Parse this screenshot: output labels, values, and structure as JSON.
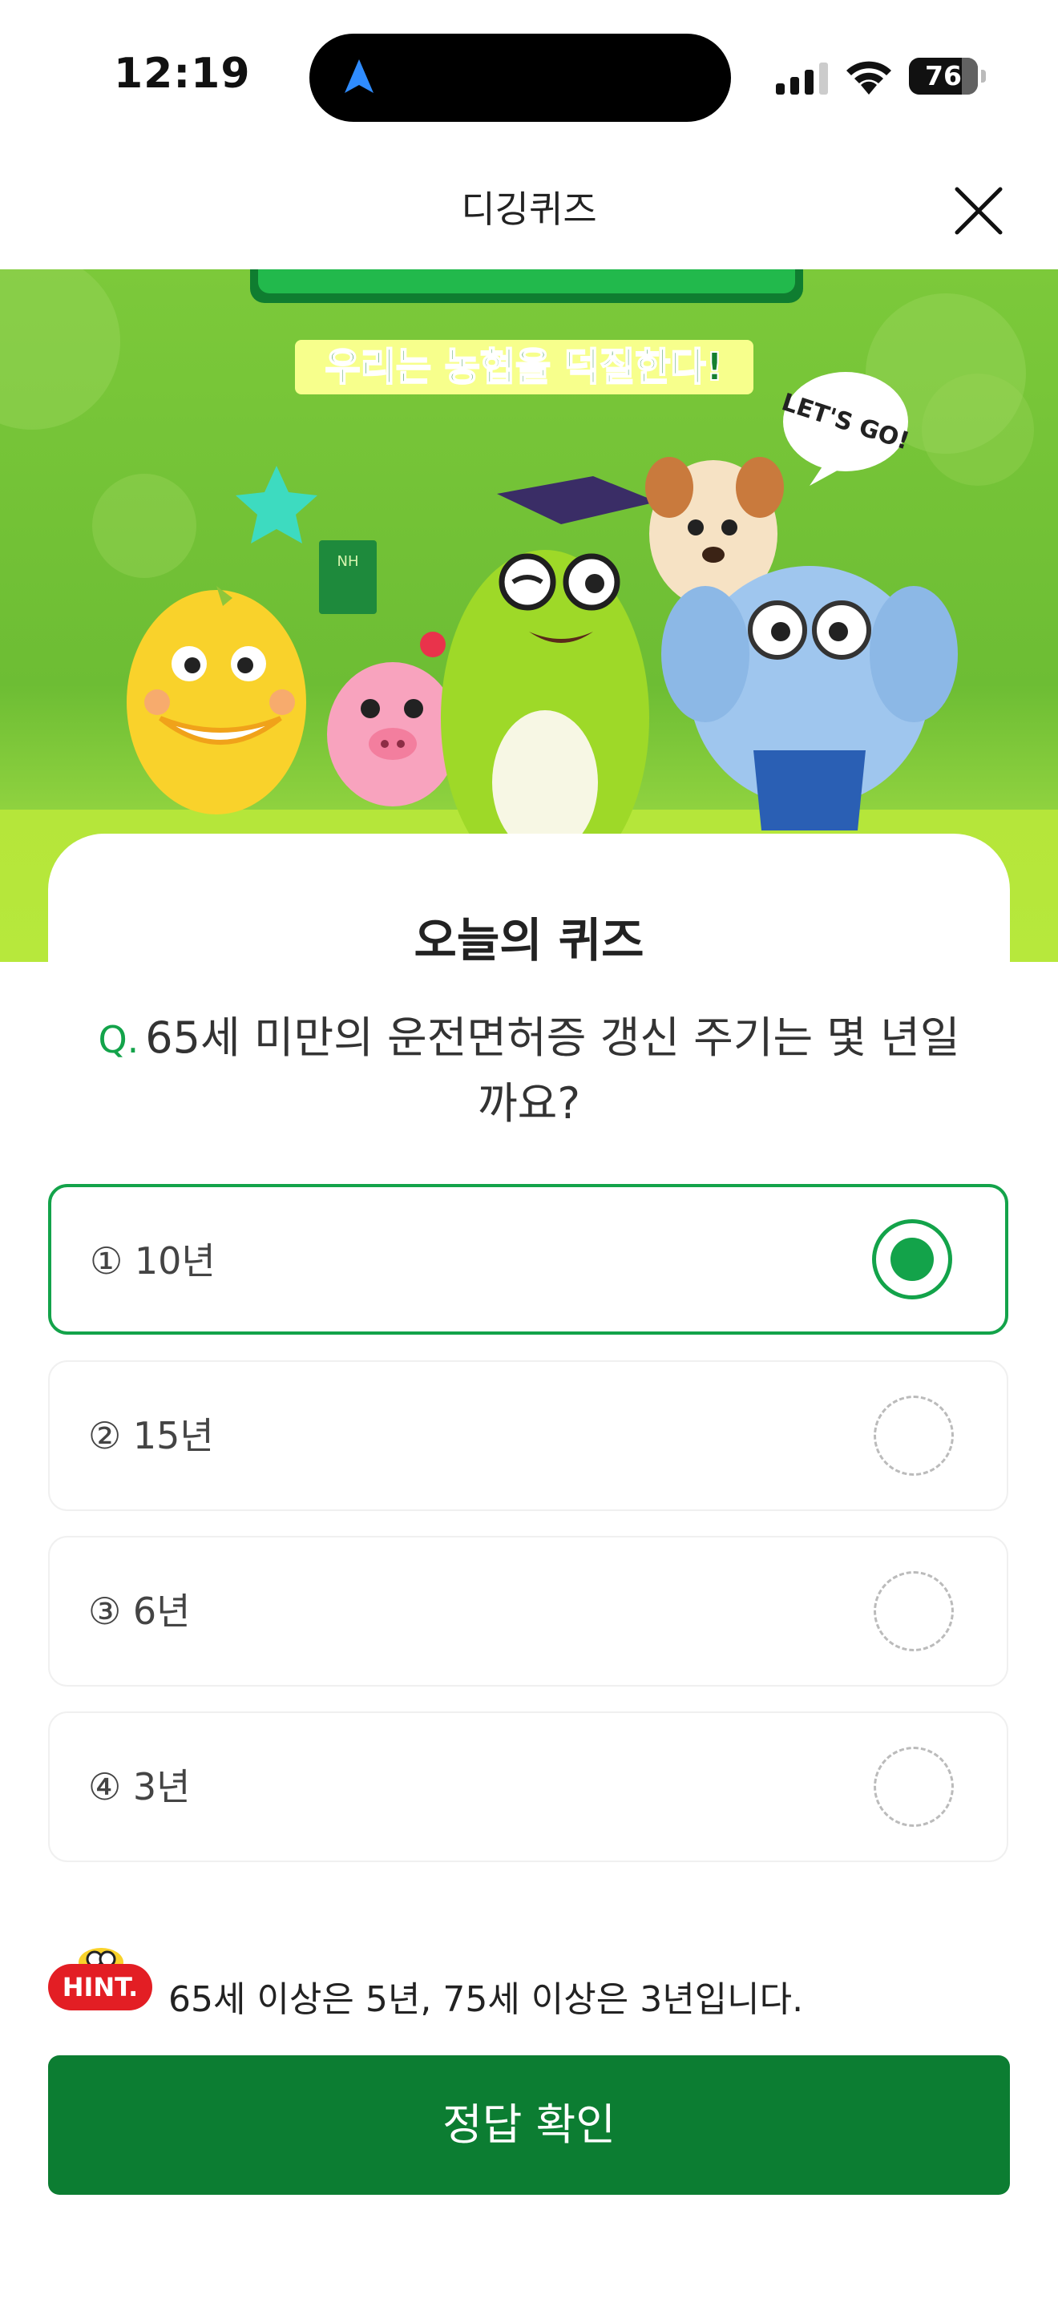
{
  "status_bar": {
    "time": "12:19",
    "battery": "76"
  },
  "header": {
    "title": "디깅퀴즈"
  },
  "banner": {
    "tagline": "우리는 농협을 덕질한다!",
    "bubble": "LET'S GO!",
    "book_text": "NH",
    "colors": {
      "bg": "#7cc93a",
      "floor": "#b5e63a",
      "logo": "#16a34a"
    }
  },
  "card": {
    "title": "오늘의 퀴즈"
  },
  "question": {
    "prefix": "Q.",
    "text": "65세 미만의 운전면허증 갱신 주기는 몇 년일까요?"
  },
  "options": [
    {
      "label": "① 10년",
      "selected": true
    },
    {
      "label": "② 15년",
      "selected": false
    },
    {
      "label": "③ 6년",
      "selected": false
    },
    {
      "label": "④ 3년",
      "selected": false
    }
  ],
  "hint": {
    "badge": "HINT.",
    "text": "65세 이상은 5년, 75세 이상은 3년입니다."
  },
  "submit": {
    "label": "정답 확인"
  },
  "colors": {
    "accent": "#13a34a",
    "button": "#0c7d32",
    "hint_badge": "#e31e24"
  }
}
